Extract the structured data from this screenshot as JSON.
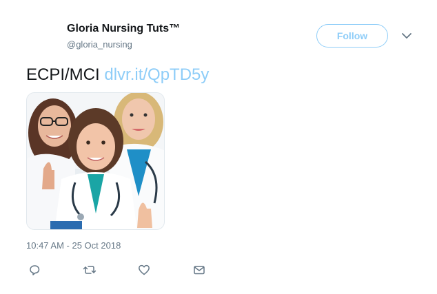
{
  "author": {
    "display_name": "Gloria Nursing Tuts™",
    "handle": "@gloria_nursing"
  },
  "header": {
    "follow_label": "Follow",
    "menu_icon": "chevron-down-icon"
  },
  "tweet": {
    "text": "ECPI/MCI ",
    "link_text": "dlvr.it/QpTD5y",
    "media_alt": "Three smiling nurses in white coats with stethoscopes, giving thumbs up",
    "timestamp": "10:47 AM - 25 Oct 2018"
  },
  "actions": [
    {
      "name": "reply",
      "icon": "reply-icon"
    },
    {
      "name": "retweet",
      "icon": "retweet-icon"
    },
    {
      "name": "like",
      "icon": "heart-icon"
    },
    {
      "name": "message",
      "icon": "envelope-icon"
    }
  ],
  "colors": {
    "accent": "#8ecdf8",
    "text": "#14171a",
    "secondary": "#657786"
  }
}
